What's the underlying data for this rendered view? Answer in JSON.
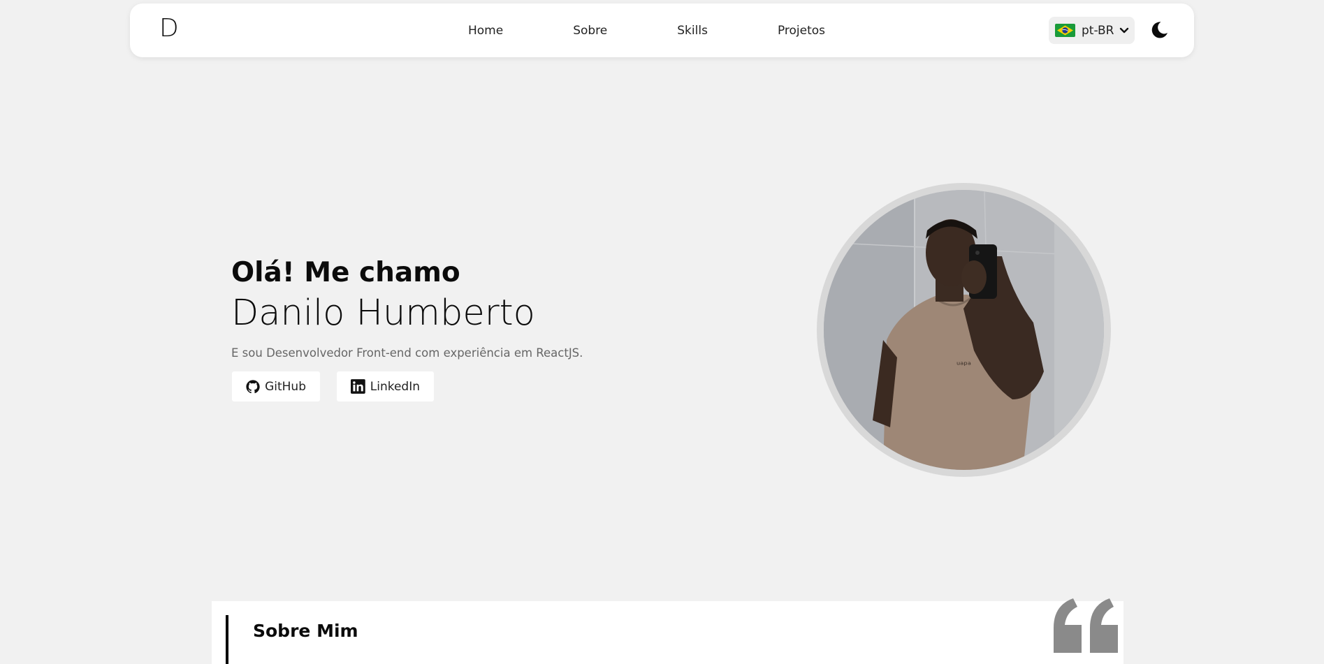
{
  "navbar": {
    "logo": "D",
    "links": [
      {
        "label": "Home"
      },
      {
        "label": "Sobre"
      },
      {
        "label": "Skills"
      },
      {
        "label": "Projetos"
      }
    ],
    "language": {
      "selected": "pt-BR",
      "flag_icon": "brazil-flag-icon"
    },
    "theme_icon": "moon-icon"
  },
  "hero": {
    "greeting": "Olá! Me chamo",
    "name": "Danilo Humberto",
    "description": "E sou Desenvolvedor Front-end com experiência em ReactJS.",
    "buttons": [
      {
        "label": "GitHub",
        "icon": "github-icon"
      },
      {
        "label": "LinkedIn",
        "icon": "linkedin-icon"
      }
    ]
  },
  "about": {
    "title": "Sobre Mim",
    "icon": "quote-icon"
  },
  "colors": {
    "background": "#f1f1f1",
    "card": "#ffffff",
    "text": "#0b0b0b",
    "muted": "#666666",
    "quote": "#8a8a8a"
  }
}
